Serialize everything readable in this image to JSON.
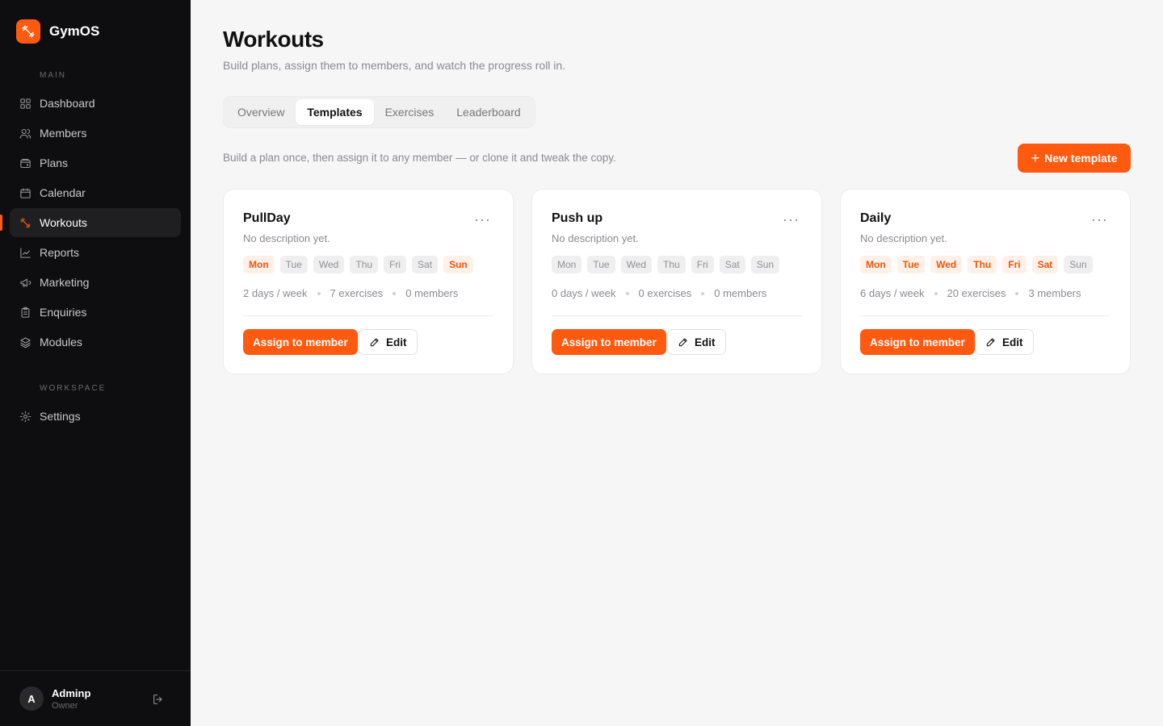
{
  "app": {
    "name": "GymOS"
  },
  "sidebar": {
    "main_label": "MAIN",
    "workspace_label": "WORKSPACE",
    "items": [
      {
        "label": "Dashboard",
        "icon": "grid-icon"
      },
      {
        "label": "Members",
        "icon": "users-icon"
      },
      {
        "label": "Plans",
        "icon": "wallet-icon"
      },
      {
        "label": "Calendar",
        "icon": "calendar-icon"
      },
      {
        "label": "Workouts",
        "icon": "dumbbell-icon",
        "active": true
      },
      {
        "label": "Reports",
        "icon": "chart-line-icon"
      },
      {
        "label": "Marketing",
        "icon": "megaphone-icon"
      },
      {
        "label": "Enquiries",
        "icon": "clipboard-icon"
      },
      {
        "label": "Modules",
        "icon": "layers-icon"
      }
    ],
    "workspace_items": [
      {
        "label": "Settings",
        "icon": "gear-icon"
      }
    ],
    "user": {
      "initial": "A",
      "name": "Adminp",
      "role": "Owner"
    }
  },
  "header": {
    "title": "Workouts",
    "subtitle": "Build plans, assign them to members, and watch the progress roll in."
  },
  "tabs": [
    {
      "label": "Overview"
    },
    {
      "label": "Templates",
      "active": true
    },
    {
      "label": "Exercises"
    },
    {
      "label": "Leaderboard"
    }
  ],
  "toolbar": {
    "helper": "Build a plan once, then assign it to any member — or clone it and tweak the copy.",
    "new_label": "New template"
  },
  "day_names": [
    "Mon",
    "Tue",
    "Wed",
    "Thu",
    "Fri",
    "Sat",
    "Sun"
  ],
  "cards": [
    {
      "title": "PullDay",
      "description": "No description yet.",
      "active_days": [
        "Mon",
        "Sun"
      ],
      "days_per_week": "2 days / week",
      "exercises": "7 exercises",
      "members": "0 members",
      "assign_label": "Assign to member",
      "edit_label": "Edit",
      "menu": "···"
    },
    {
      "title": "Push up",
      "description": "No description yet.",
      "active_days": [],
      "days_per_week": "0 days / week",
      "exercises": "0 exercises",
      "members": "0 members",
      "assign_label": "Assign to member",
      "edit_label": "Edit",
      "menu": "···"
    },
    {
      "title": "Daily",
      "description": "No description yet.",
      "active_days": [
        "Mon",
        "Tue",
        "Wed",
        "Thu",
        "Fri",
        "Sat"
      ],
      "days_per_week": "6 days / week",
      "exercises": "20 exercises",
      "members": "3 members",
      "assign_label": "Assign to member",
      "edit_label": "Edit",
      "menu": "···"
    }
  ],
  "colors": {
    "accent": "#ff5a0f",
    "sidebar_bg": "#0e0e10",
    "page_bg": "#f6f6f7"
  }
}
